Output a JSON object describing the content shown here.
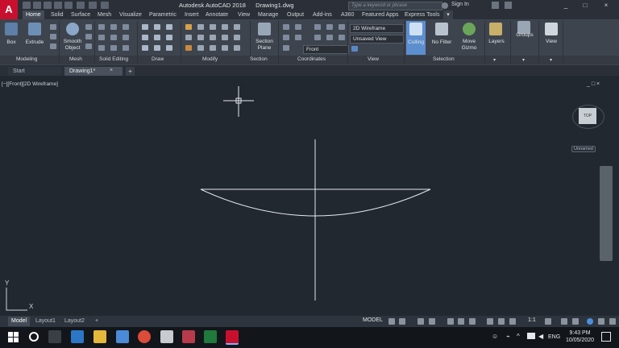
{
  "titlebar": {
    "app_name": "Autodesk AutoCAD 2018",
    "file_name": "Drawing1.dwg",
    "search_placeholder": "Type a keyword or phrase",
    "signin_label": "Sign In",
    "app_logo": "A"
  },
  "ribbon_tabs": [
    "Home",
    "Solid",
    "Surface",
    "Mesh",
    "Visualize",
    "Parametric",
    "Insert",
    "Annotate",
    "View",
    "Manage",
    "Output",
    "Add-ins",
    "A360",
    "Featured Apps",
    "Express Tools"
  ],
  "ribbon": {
    "box_label": "Box",
    "extrude_label": "Extrude",
    "smooth_object_label": "Smooth Object",
    "section_plane_label": "Section Plane",
    "visual_style_value": "2D Wireframe",
    "saved_view_value": "Unsaved View",
    "view_direction_value": "Front",
    "culling_label": "Culling",
    "no_filter_label": "No Filter",
    "move_gizmo_label": "Move Gizmo",
    "layers_label": "Layers",
    "groups_label": "Groups",
    "view_label": "View"
  },
  "panel_titles": [
    "Modeling",
    "Mesh",
    "Solid Editing",
    "Draw",
    "Modify",
    "Section",
    "Coordinates",
    "View",
    "Selection"
  ],
  "file_tabs": {
    "start_label": "Start",
    "drawing_label": "Drawing1*",
    "new_tab_label": "+"
  },
  "viewport": {
    "label": "[−][Front][2D Wireframe]",
    "controls": "_ □ ×",
    "viewcube_face": "TOP",
    "wcs_label": "Unnamed",
    "ucs_y": "Y",
    "ucs_x": "X"
  },
  "layout_tabs": [
    "Model",
    "Layout1",
    "Layout2",
    "+"
  ],
  "statusbar": {
    "model_label": "MODEL",
    "scale_label": "1:1"
  },
  "taskbar": {
    "language": "ENG",
    "time": "9:43 PM",
    "date": "10/05/2020"
  }
}
